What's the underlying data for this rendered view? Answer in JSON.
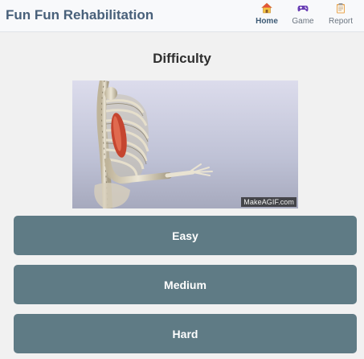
{
  "header": {
    "app_title": "Fun Fun Rehabilitation",
    "nav": [
      {
        "label": "Home",
        "icon": "home-icon",
        "active": true
      },
      {
        "label": "Game",
        "icon": "gamepad-icon",
        "active": false
      },
      {
        "label": "Report",
        "icon": "clipboard-icon",
        "active": false
      }
    ]
  },
  "main": {
    "title": "Difficulty",
    "media": {
      "watermark": "MakeAGIF.com"
    },
    "buttons": [
      {
        "label": "Easy"
      },
      {
        "label": "Medium"
      },
      {
        "label": "Hard"
      }
    ]
  },
  "colors": {
    "button_bg": "#5f7b85",
    "title_color": "#48607a",
    "active_nav": "#3d5a75"
  }
}
